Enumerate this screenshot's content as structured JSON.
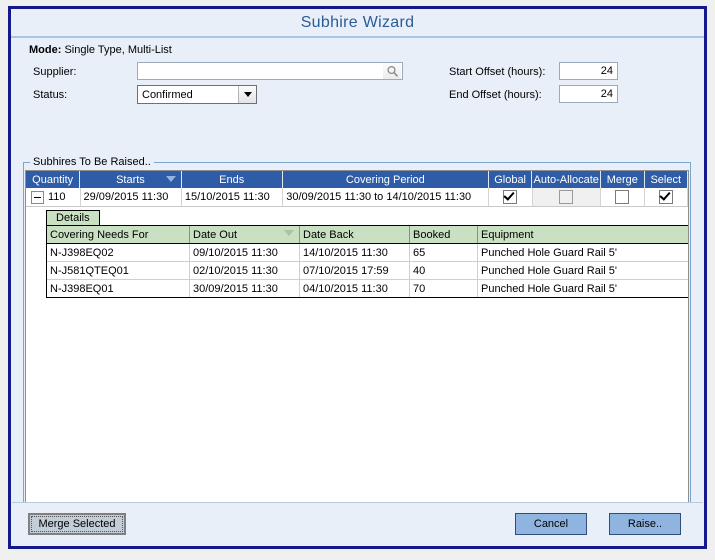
{
  "window": {
    "title": "Subhire Wizard"
  },
  "mode": {
    "label": "Mode:",
    "value": "Single Type, Multi-List"
  },
  "form": {
    "supplier_label": "Supplier:",
    "supplier_value": "",
    "supplier_placeholder": "",
    "search_icon": "search-icon",
    "status_label": "Status:",
    "status_value": "Confirmed",
    "start_offset_label": "Start Offset (hours):",
    "start_offset_value": "24",
    "end_offset_label": "End Offset (hours):",
    "end_offset_value": "24"
  },
  "group": {
    "legend": "Subhires To Be Raised.."
  },
  "main_grid": {
    "columns": [
      "Quantity",
      "Starts",
      "Ends",
      "Covering Period",
      "Global",
      "Auto-Allocate",
      "Merge",
      "Select"
    ],
    "sorted_column": "Starts",
    "row": {
      "quantity": "110",
      "starts": "29/09/2015 11:30",
      "ends": "15/10/2015 11:30",
      "covering_period": "30/09/2015 11:30 to 14/10/2015 11:30",
      "global_checked": true,
      "auto_allocate_checked": false,
      "auto_allocate_disabled": true,
      "merge_checked": false,
      "select_checked": true
    }
  },
  "detail": {
    "tab_label": "Details",
    "columns": [
      "Covering Needs For",
      "Date Out",
      "Date Back",
      "Booked",
      "Equipment"
    ],
    "sorted_column": "Date Out",
    "rows": [
      {
        "covering_needs_for": "N-J398EQ02",
        "date_out": "09/10/2015 11:30",
        "date_back": "14/10/2015 11:30",
        "booked": "65",
        "equipment": "Punched Hole Guard Rail 5'"
      },
      {
        "covering_needs_for": "N-J581QTEQ01",
        "date_out": "02/10/2015 11:30",
        "date_back": "07/10/2015 17:59",
        "booked": "40",
        "equipment": "Punched Hole Guard Rail 5'"
      },
      {
        "covering_needs_for": "N-J398EQ01",
        "date_out": "30/09/2015 11:30",
        "date_back": "04/10/2015 11:30",
        "booked": "70",
        "equipment": "Punched Hole Guard Rail 5'"
      }
    ]
  },
  "footer": {
    "merge_selected_label": "Merge Selected",
    "cancel_label": "Cancel",
    "raise_label": "Raise.."
  },
  "colors": {
    "window_border": "#141a8c",
    "title_text": "#2a5c96",
    "grid_header": "#2f5ca6",
    "detail_header": "#c9e0c2",
    "button_blue": "#8fb4e0"
  }
}
